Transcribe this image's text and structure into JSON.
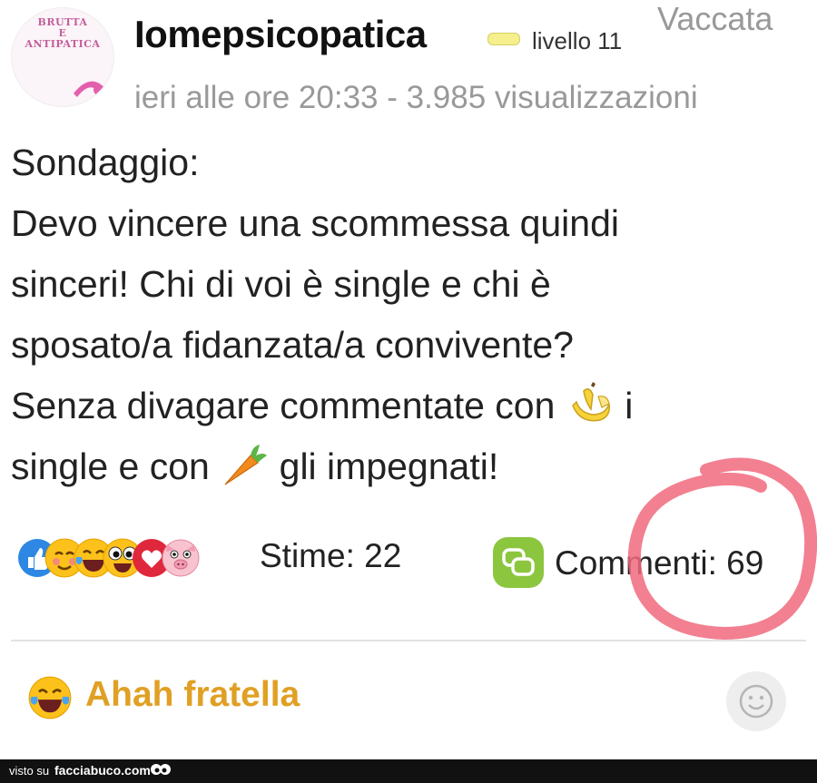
{
  "post": {
    "avatar": {
      "line1": "BRUTTA",
      "line2": "E",
      "line3": "ANTIPATICA"
    },
    "username": "Iomepsicopatica",
    "level": "livello 11",
    "corner_tag": "Vaccata",
    "meta": "ieri alle ore 20:33 - 3.985 visualizzazioni",
    "body_lines": [
      "Sondaggio:",
      "Devo vincere una scommessa quindi",
      "sinceri! Chi di voi è single e chi è",
      "sposato/a fidanzata/a convivente?",
      "Senza divagare commentate con",
      "i",
      "single e con",
      "gli impegnati!"
    ],
    "inline_icons": [
      "banana-icon",
      "carrot-icon"
    ]
  },
  "stats": {
    "reaction_icons": [
      "thumbs-up-icon",
      "blush-icon",
      "tears-of-joy-icon",
      "big-eyes-icon",
      "heart-icon",
      "pig-icon"
    ],
    "likes": "Stime: 22",
    "comments": "Commenti: 69"
  },
  "reply": {
    "text": "Ahah fratella",
    "emoji": "tears-of-joy-icon"
  },
  "footer": {
    "visto": "visto su",
    "site": "facciabuco.com"
  },
  "colors": {
    "reply_text": "#e0a024",
    "annotation_circle": "#f06a7d",
    "comment_icon": "#8cc63f",
    "meta_text": "#999999"
  }
}
